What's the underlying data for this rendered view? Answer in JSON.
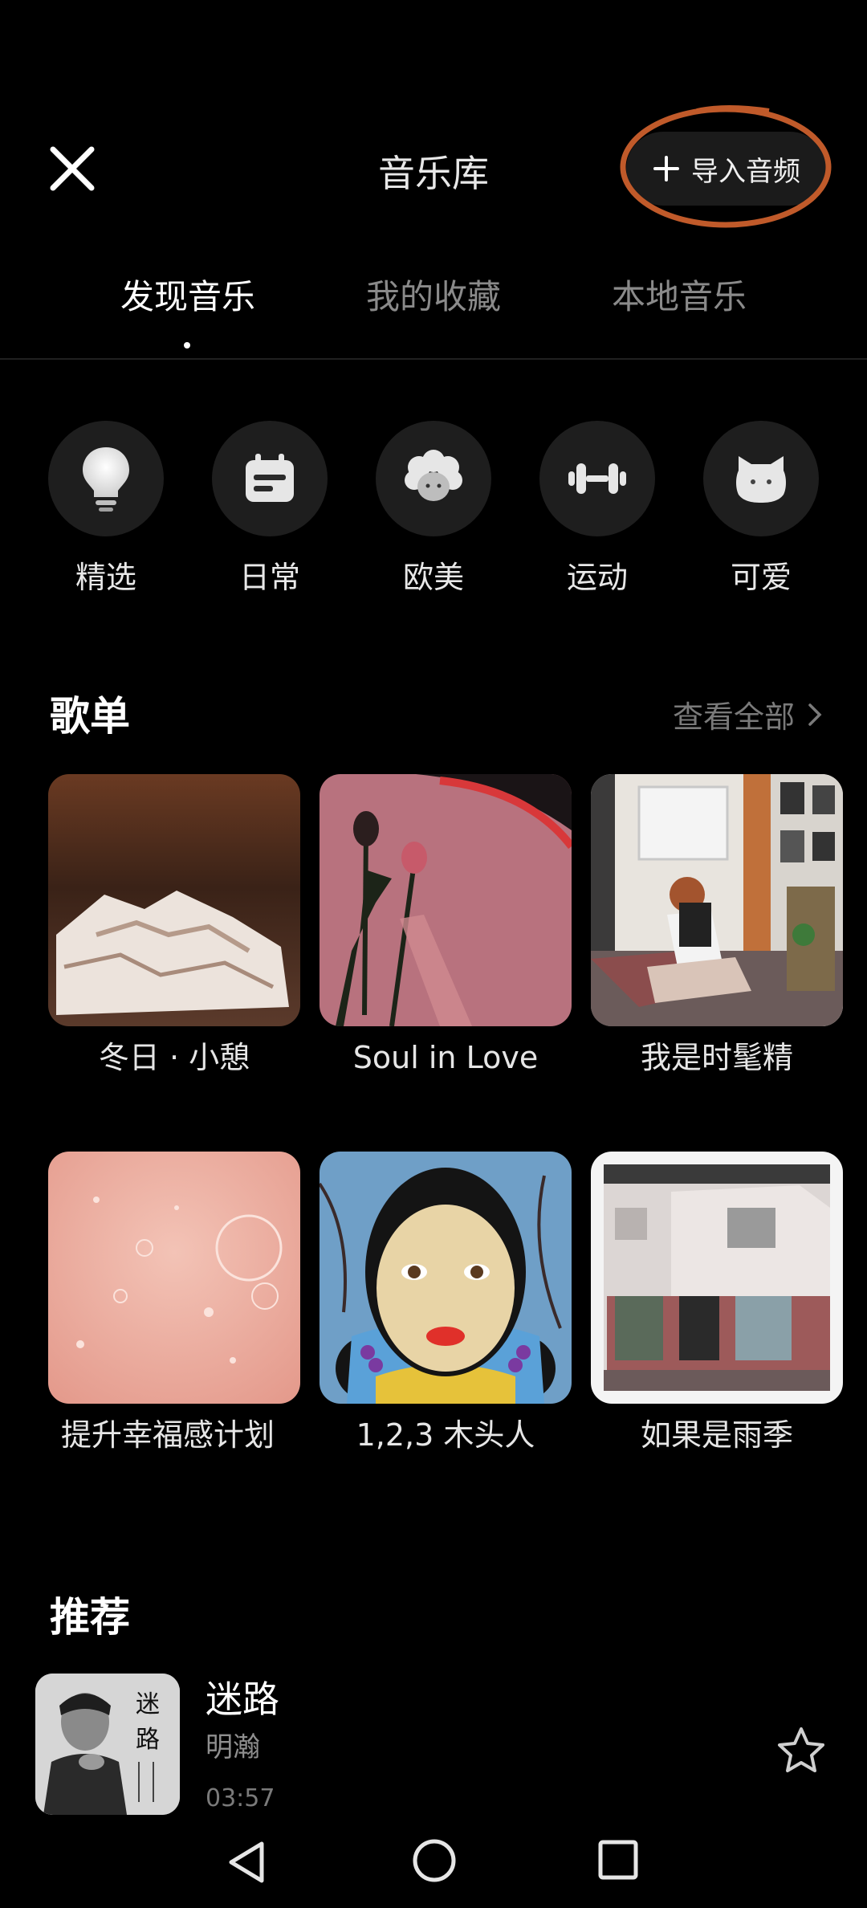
{
  "header": {
    "title": "音乐库",
    "import_label": "导入音频",
    "ring_color": "#c05a2a"
  },
  "tabs": [
    {
      "label": "发现音乐",
      "active": true
    },
    {
      "label": "我的收藏",
      "active": false
    },
    {
      "label": "本地音乐",
      "active": false
    }
  ],
  "categories": [
    {
      "label": "精选",
      "icon": "lightbulb-icon"
    },
    {
      "label": "日常",
      "icon": "calendar-icon"
    },
    {
      "label": "欧美",
      "icon": "curly-hair-avatar-icon"
    },
    {
      "label": "运动",
      "icon": "dumbbell-icon"
    },
    {
      "label": "可爱",
      "icon": "cat-face-icon"
    }
  ],
  "playlists_section": {
    "title": "歌单",
    "view_all": "查看全部"
  },
  "playlists": [
    {
      "name": "冬日 · 小憩"
    },
    {
      "name": "Soul in Love"
    },
    {
      "name": "我是时髦精"
    },
    {
      "name": "提升幸福感计划"
    },
    {
      "name": "1,2,3 木头人"
    },
    {
      "name": "如果是雨季"
    }
  ],
  "recommend_section": {
    "title": "推荐"
  },
  "songs": [
    {
      "title": "迷路",
      "artist": "明瀚",
      "duration": "03:57",
      "cover_text": "迷路"
    }
  ],
  "nav": {
    "icons": [
      "back-triangle-icon",
      "home-circle-icon",
      "recents-square-icon"
    ]
  }
}
